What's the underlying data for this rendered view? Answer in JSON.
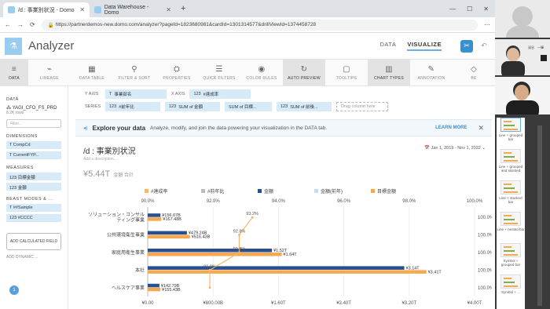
{
  "browser": {
    "tabs": [
      {
        "label": "/d : 事業別状況 - Domo",
        "active": true
      },
      {
        "label": "Data Warehouse - Domo",
        "active": false
      }
    ],
    "url": "https://partnerdemos-new.domo.com/analyzer?pageId=1823680981&cardId=1301314577&drillViewId=1374458728"
  },
  "app": {
    "title": "Analyzer",
    "mode_data": "DATA",
    "mode_visualize": "VISUALIZE"
  },
  "toolbar": {
    "items": [
      "DATA",
      "LINEAGE",
      "DATA TABLE",
      "FILTER & SORT",
      "PROPERTIES",
      "QUICK FILTERS",
      "COLOR RULES",
      "AUTO PREVIEW",
      "TOOLTIPS",
      "CHART TYPES",
      "ANNOTATION",
      "BE"
    ]
  },
  "left": {
    "data_label": "DATA",
    "dataset": "YAGI_CFO_FS_PRD",
    "rows": "8.2K rows",
    "filter_placeholder": "Filter...",
    "dimensions_label": "DIMENSIONS",
    "dimensions": [
      "CompCd",
      "CurrentFYP..."
    ],
    "measures_label": "MEASURES",
    "measures": [
      "目標金額",
      "金額"
    ],
    "beast_label": "BEAST MODES & ...",
    "beast": [
      "##Sample",
      "#CCCC"
    ],
    "add_calc": "ADD CALCULATED FIELD",
    "dynamic": "ADD DYNAMIC ..."
  },
  "axes": {
    "yaxis_label": "Y AXIS",
    "yaxis_value": "事業部名",
    "xaxis_label": "X AXIS",
    "xaxis_value": "#達成率",
    "series_label": "SERIES",
    "series": [
      "#前年比",
      "SUM of 金額",
      "SUM of 目標...",
      "SUM of 前後..."
    ],
    "drag_hint": "Drag column here"
  },
  "banner": {
    "title": "Explore your data",
    "text": "Analyze, modify, and join the data powering your visualization in the DATA tab.",
    "learn_more": "LEARN MORE"
  },
  "card": {
    "title": "/d : 事業別状況",
    "description": "Add a description...",
    "date_range": "Jan 1, 2019 - Nov 1, 2022",
    "summary_value": "¥5.44T",
    "summary_label": "金額 合計"
  },
  "chart_data": {
    "type": "bar",
    "legend": [
      "#達成率",
      "#前年比",
      "金額",
      "金額(前年)",
      "目標金額"
    ],
    "categories": [
      "ソリューション・コンサルティング事業",
      "公共環境衛生事業",
      "家庭用衛生事業",
      "本社",
      "ヘルスケア事業"
    ],
    "series": [
      {
        "name": "金額",
        "values": [
          "¥156.07B",
          "¥479.24B",
          "¥1.52T",
          "¥3.14T",
          "¥142.79B"
        ],
        "numeric": [
          156.07,
          479.24,
          1520,
          3140,
          142.79
        ]
      },
      {
        "name": "目標金額",
        "values": [
          "¥167.48B",
          "¥516.43B",
          "¥1.64T",
          "¥3.41T",
          "¥155.43B"
        ],
        "numeric": [
          167.48,
          516.43,
          1640,
          3410,
          155.43
        ]
      }
    ],
    "line_labels": [
      "93.2%",
      "92.8%",
      "92.8%",
      "91.9%"
    ],
    "top_ticks": [
      "90.0%",
      "92.0%",
      "94.0%",
      "96.0%",
      "98.0%",
      "100.0%"
    ],
    "bottom_ticks": [
      "¥0.00",
      "¥800.00B",
      "¥1.60T",
      "¥2.40T",
      "¥3.20T",
      "¥4.00T"
    ],
    "right_ticks": [
      "100.0%",
      "100.0%",
      "100.0%",
      "100.0%",
      "100.0%"
    ],
    "xlim": [
      0,
      4000
    ],
    "colors": {
      "bar_primary": "#2a4f8f",
      "bar_secondary": "#f5a850",
      "line": "#f5b86a"
    }
  },
  "chart_types": [
    "Line + grouped bar",
    "Line + grouped and stacked",
    "Line + stacked bar",
    "Line + nested bar",
    "Symbol + grouped bar",
    "Symbol + ..."
  ],
  "webcam": {
    "name_line": "深谷　一輝"
  }
}
